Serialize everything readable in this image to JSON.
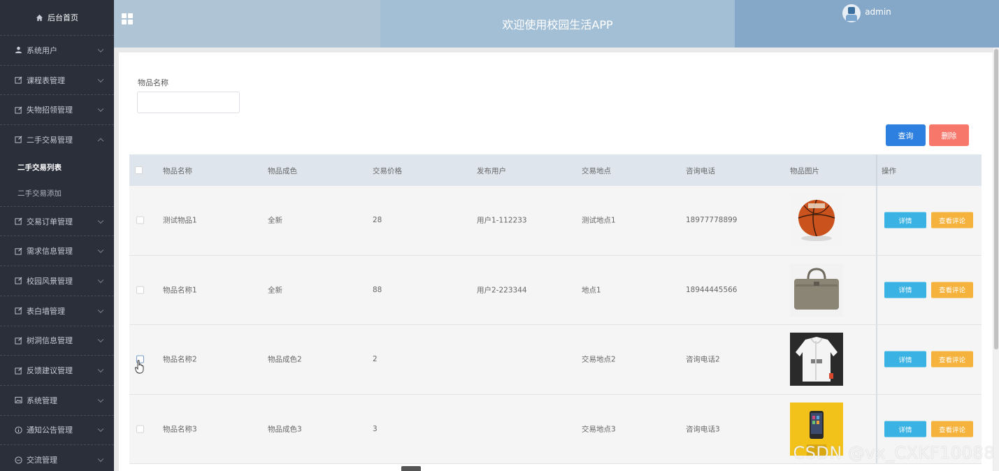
{
  "sidebar": {
    "home_label": "后台首页",
    "items": [
      {
        "label": "系统用户",
        "icon": "user-icon"
      },
      {
        "label": "课程表管理",
        "icon": "edit-icon"
      },
      {
        "label": "失物招领管理",
        "icon": "edit-icon"
      },
      {
        "label": "二手交易管理",
        "icon": "edit-icon",
        "expanded": true,
        "children": [
          {
            "label": "二手交易列表",
            "active": true
          },
          {
            "label": "二手交易添加",
            "active": false
          }
        ]
      },
      {
        "label": "交易订单管理",
        "icon": "edit-icon"
      },
      {
        "label": "需求信息管理",
        "icon": "edit-icon"
      },
      {
        "label": "校园风景管理",
        "icon": "edit-icon"
      },
      {
        "label": "表白墙管理",
        "icon": "edit-icon"
      },
      {
        "label": "树洞信息管理",
        "icon": "edit-icon"
      },
      {
        "label": "反馈建议管理",
        "icon": "edit-icon"
      },
      {
        "label": "系统管理",
        "icon": "image-icon"
      },
      {
        "label": "通知公告管理",
        "icon": "info-icon"
      },
      {
        "label": "交流管理",
        "icon": "chat-icon"
      }
    ]
  },
  "header": {
    "title": "欢迎使用校园生活APP",
    "username": "admin"
  },
  "filter": {
    "label": "物品名称",
    "value": "",
    "query_label": "查询",
    "delete_label": "删除"
  },
  "table": {
    "columns": [
      "物品名称",
      "物品成色",
      "交易价格",
      "发布用户",
      "交易地点",
      "咨询电话",
      "物品图片",
      "操作"
    ],
    "rows": [
      {
        "name": "测试物品1",
        "condition": "全新",
        "price": "28",
        "user": "用户1-112233",
        "location": "测试地点1",
        "phone": "18977778899",
        "image": "basketball"
      },
      {
        "name": "物品名称1",
        "condition": "全新",
        "price": "88",
        "user": "用户2-223344",
        "location": "地点1",
        "phone": "18944445566",
        "image": "bag"
      },
      {
        "name": "物品名称2",
        "condition": "物品成色2",
        "price": "2",
        "user": "",
        "location": "交易地点2",
        "phone": "咨询电话2",
        "image": "jacket"
      },
      {
        "name": "物品名称3",
        "condition": "物品成色3",
        "price": "3",
        "user": "",
        "location": "交易地点3",
        "phone": "咨询电话3",
        "image": "phone"
      }
    ],
    "detail_label": "详情",
    "comment_label": "查看评论"
  },
  "watermark": "CSDN @vx_CXKF10088",
  "colors": {
    "sidebar_bg": "#2b2f3a",
    "query_button": "#2d7fe0",
    "delete_button": "#f7786b",
    "detail_button": "#3ab2e3",
    "comment_button": "#f5b23c"
  }
}
